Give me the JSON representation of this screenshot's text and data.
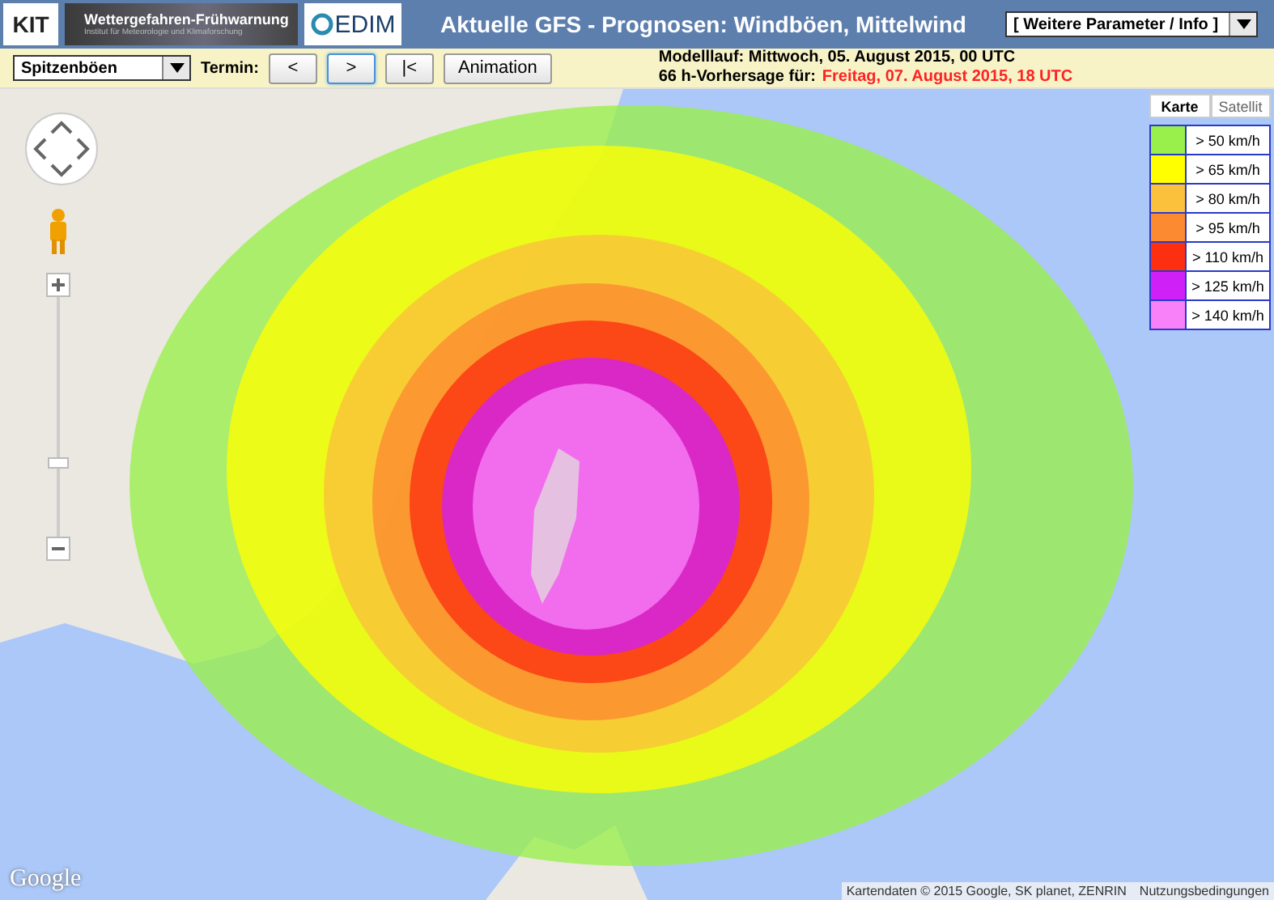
{
  "header": {
    "logos": {
      "kit": "KIT",
      "banner_title": "Wettergefahren-Frühwarnung",
      "banner_subtitle": "Institut für Meteorologie und Klimaforschung",
      "cedim": "EDIM"
    },
    "title": "Aktuelle GFS - Prognosen: Windböen, Mittelwind",
    "param_select": "[ Weitere Parameter / Info ]"
  },
  "toolbar": {
    "product_select": "Spitzenböen",
    "termin_label": "Termin:",
    "buttons": [
      {
        "label": "<",
        "selected": false
      },
      {
        "label": ">",
        "selected": true
      },
      {
        "label": "|<",
        "selected": false
      },
      {
        "label": "Animation",
        "selected": false
      }
    ],
    "model_run": "Modelllauf: Mittwoch, 05. August 2015, 00 UTC",
    "forecast_label": "66 h-Vorhersage für:",
    "forecast_time": "Freitag, 07. August 2015, 18 UTC"
  },
  "map": {
    "map_types": [
      {
        "label": "Karte",
        "selected": true
      },
      {
        "label": "Satellit",
        "selected": false
      }
    ],
    "legend": [
      {
        "label": "> 50 km/h",
        "color": "#99f04a"
      },
      {
        "label": "> 65 km/h",
        "color": "#ffff00"
      },
      {
        "label": "> 80 km/h",
        "color": "#fbc03c"
      },
      {
        "label": "> 95 km/h",
        "color": "#fc8a30"
      },
      {
        "label": "> 110 km/h",
        "color": "#fc3010"
      },
      {
        "label": "> 125 km/h",
        "color": "#d020f8"
      },
      {
        "label": "> 140 km/h",
        "color": "#f880f8"
      }
    ],
    "google": "Google",
    "attribution": "Kartendaten © 2015 Google, SK planet, ZENRIN",
    "terms": "Nutzungsbedingungen"
  }
}
